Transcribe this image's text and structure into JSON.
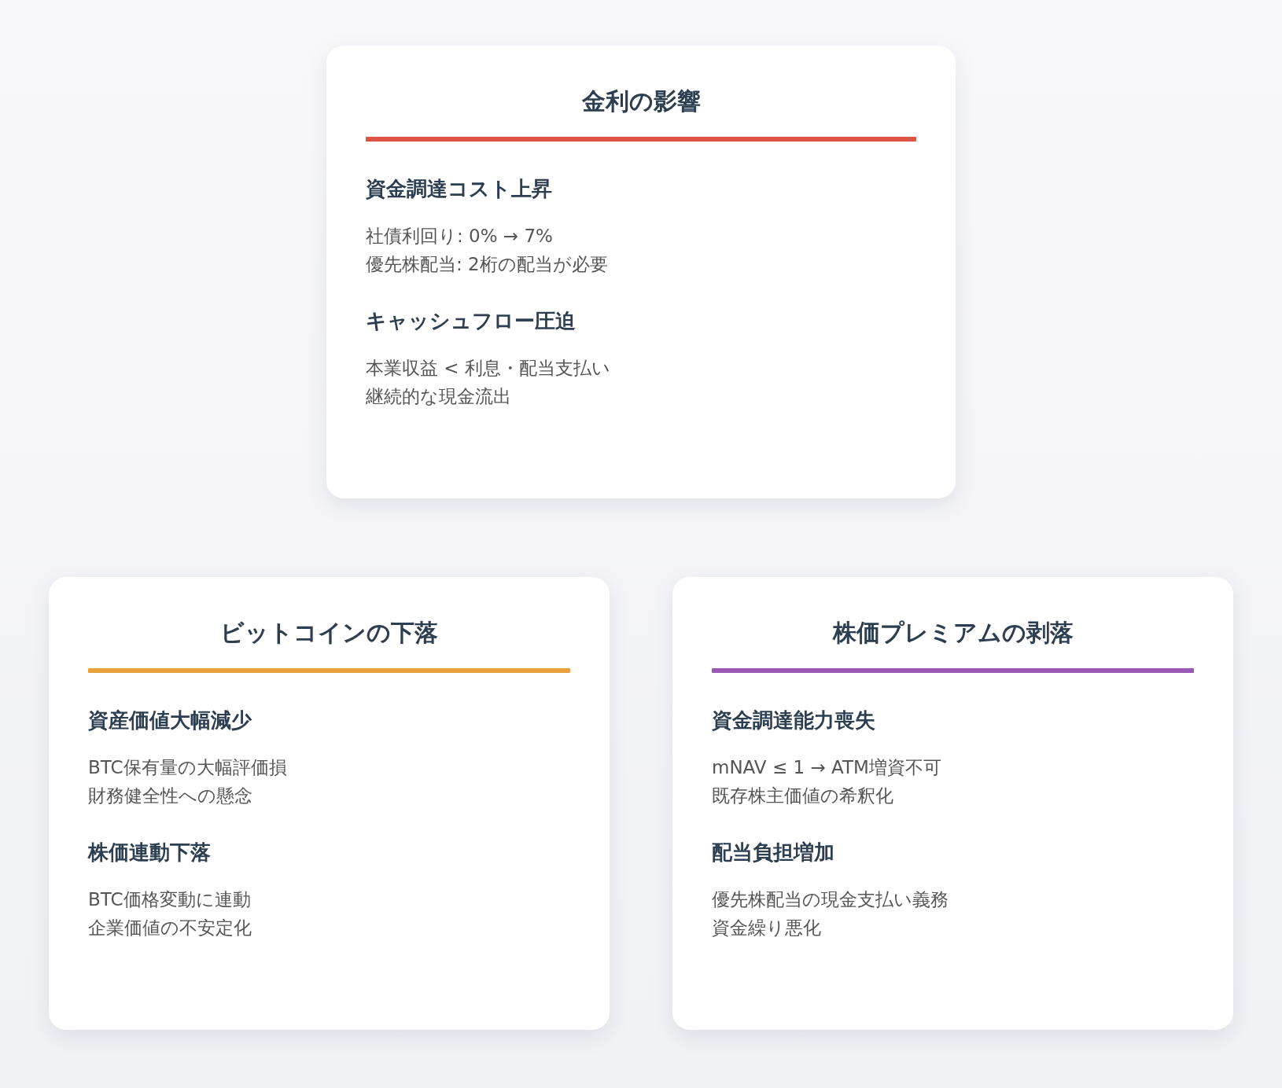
{
  "cards": [
    {
      "title": "金利の影響",
      "color": "#dc5444",
      "sections": [
        {
          "heading": "資金調達コスト上昇",
          "lines": [
            "社債利回り: 0% → 7%",
            "優先株配当: 2桁の配当が必要"
          ]
        },
        {
          "heading": "キャッシュフロー圧迫",
          "lines": [
            "本業収益 < 利息・配当支払い",
            "継続的な現金流出"
          ]
        }
      ]
    },
    {
      "title": "ビットコインの下落",
      "color": "#e8a23b",
      "sections": [
        {
          "heading": "資産価値大幅減少",
          "lines": [
            "BTC保有量の大幅評価損",
            "財務健全性への懸念"
          ]
        },
        {
          "heading": "株価連動下落",
          "lines": [
            "BTC価格変動に連動",
            "企業価値の不安定化"
          ]
        }
      ]
    },
    {
      "title": "株価プレミアムの剥落",
      "color": "#9b59b6",
      "sections": [
        {
          "heading": "資金調達能力喪失",
          "lines": [
            "mNAV ≤ 1 → ATM増資不可",
            "既存株主価値の希釈化"
          ]
        },
        {
          "heading": "配当負担増加",
          "lines": [
            "優先株配当の現金支払い義務",
            "資金繰り悪化"
          ]
        }
      ]
    }
  ]
}
